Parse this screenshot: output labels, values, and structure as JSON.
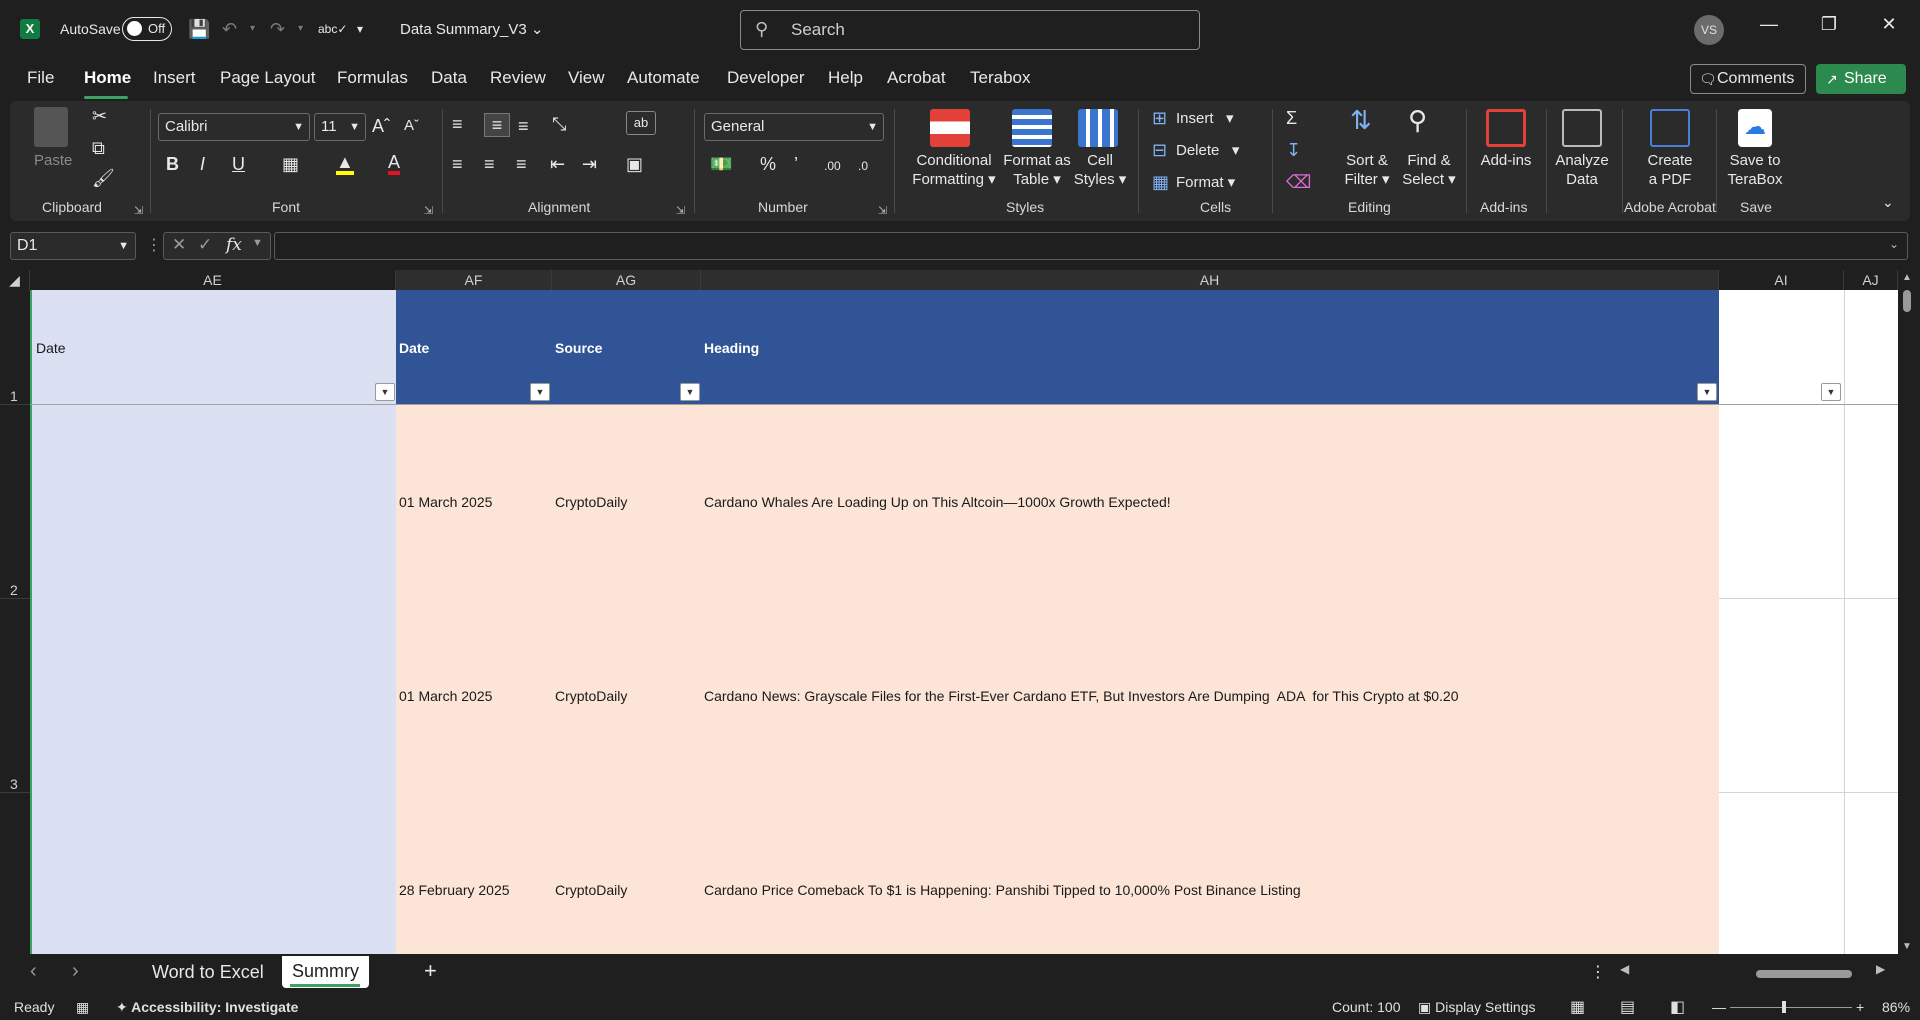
{
  "titlebar": {
    "autosave_label": "AutoSave",
    "autosave_state": "Off",
    "doc_title": "Data Summary_V3",
    "search_placeholder": "Search",
    "avatar_initials": "VS"
  },
  "menu": {
    "tabs": [
      "File",
      "Home",
      "Insert",
      "Page Layout",
      "Formulas",
      "Data",
      "Review",
      "View",
      "Automate",
      "Developer",
      "Help",
      "Acrobat",
      "Terabox"
    ],
    "active_tab": "Home",
    "comments_label": "Comments",
    "share_label": "Share"
  },
  "ribbon": {
    "clipboard": {
      "paste": "Paste",
      "label": "Clipboard"
    },
    "font": {
      "name": "Calibri",
      "size": "11",
      "label": "Font"
    },
    "alignment": {
      "label": "Alignment"
    },
    "number": {
      "format": "General",
      "label": "Number"
    },
    "styles": {
      "conditional": [
        "Conditional",
        "Formatting"
      ],
      "format_table": [
        "Format as",
        "Table"
      ],
      "cell_styles": [
        "Cell",
        "Styles"
      ],
      "label": "Styles"
    },
    "cells": {
      "insert": "Insert",
      "delete": "Delete",
      "format": "Format",
      "label": "Cells"
    },
    "editing": {
      "sort": [
        "Sort &",
        "Filter"
      ],
      "find": [
        "Find &",
        "Select"
      ],
      "label": "Editing"
    },
    "addins": {
      "addins": "Add-ins",
      "label": "Add-ins"
    },
    "analyze": [
      "Analyze",
      "Data"
    ],
    "acrobat": {
      "create": [
        "Create",
        "a PDF"
      ],
      "label": "Adobe Acrobat"
    },
    "save": {
      "save_to": [
        "Save to",
        "TeraBox"
      ],
      "label": "Save"
    }
  },
  "formula_bar": {
    "name_box": "D1",
    "formula": ""
  },
  "grid": {
    "columns": [
      "AE",
      "AF",
      "AG",
      "AH",
      "AI",
      "AJ"
    ],
    "rows": [
      "1",
      "2",
      "3"
    ],
    "header_row": {
      "ae": "Date",
      "af": "Date",
      "ag": "Source",
      "ah": "Heading"
    },
    "data_rows": [
      {
        "date": "01 March 2025",
        "source": "CryptoDaily",
        "heading": "Cardano Whales Are Loading Up on This Altcoin—1000x Growth Expected!"
      },
      {
        "date": "01 March 2025",
        "source": "CryptoDaily",
        "heading": "Cardano News: Grayscale Files for the First-Ever Cardano ETF, But Investors Are Dumping  ADA  for This Crypto at $0.20"
      },
      {
        "date": "28 February 2025",
        "source": "CryptoDaily",
        "heading": "Cardano Price Comeback To $1 is Happening: Panshibi Tipped to 10,000% Post Binance Listing"
      }
    ],
    "colors": {
      "ae_fill": "#dbe0f3",
      "header_fill": "#305496",
      "data_fill": "#fce4d6"
    }
  },
  "sheets": {
    "tabs": [
      "Word to Excel",
      "Summry"
    ],
    "active": "Summry"
  },
  "status": {
    "ready": "Ready",
    "accessibility": "Accessibility: Investigate",
    "count": "Count: 100",
    "display_settings": "Display Settings",
    "zoom": "86%"
  }
}
